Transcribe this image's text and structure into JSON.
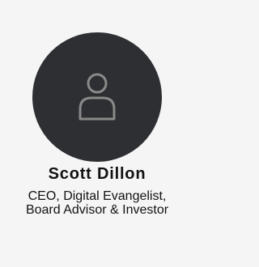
{
  "profile": {
    "name": "Scott Dillon",
    "title": "CEO, Digital Evangelist, Board Advisor & Investor",
    "avatar_icon": "user-placeholder-icon"
  },
  "colors": {
    "background": "#f5f5f5",
    "avatar_bg": "#2e2f33",
    "icon_stroke": "#8a8a8a",
    "text": "#111111"
  }
}
